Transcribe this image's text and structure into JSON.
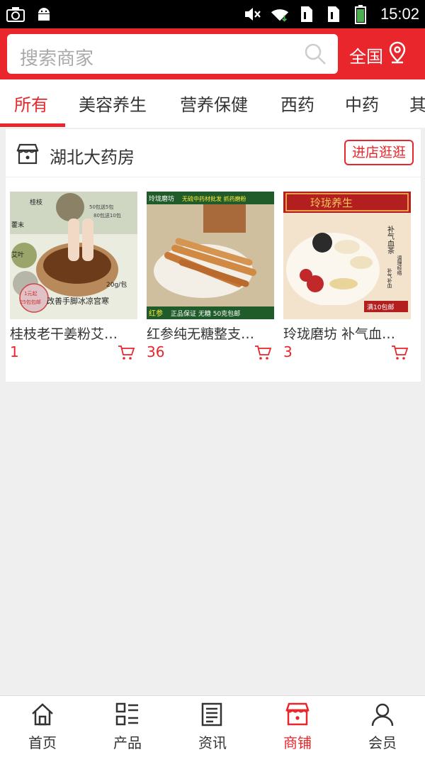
{
  "status_bar": {
    "time": "15:02",
    "icons": [
      "camera-icon",
      "android-icon",
      "mute-icon",
      "wifi-icon",
      "sim1-icon",
      "sim2-icon",
      "battery-icon"
    ]
  },
  "header": {
    "search_placeholder": "搜索商家",
    "region_label": "全国",
    "accent": "#e8262b"
  },
  "tabs": [
    {
      "label": "所有",
      "active": true
    },
    {
      "label": "美容养生"
    },
    {
      "label": "营养保健"
    },
    {
      "label": "西药"
    },
    {
      "label": "中药"
    },
    {
      "label": "其"
    }
  ],
  "shop": {
    "name": "湖北大药房",
    "enter_label": "进店逛逛",
    "products": [
      {
        "title": "桂枝老干姜粉艾…",
        "count": "1",
        "img_text": {
          "a": "桂枝",
          "b": "藿末",
          "c": "艾叶",
          "d": "50包送5包",
          "e": "80包送10包",
          "f": "20g/包",
          "g": "改善手脚冰凉宫寒",
          "h": "1元起",
          "i": "25包包邮"
        }
      },
      {
        "title": "红参纯无糖整支…",
        "count": "36",
        "img_text": {
          "a": "玲珑磨坊",
          "b": "无硫中药材批发 抓药磨粉",
          "c": "红参",
          "d": "正品保证 无糖 50克包邮"
        }
      },
      {
        "title": "玲珑磨坊 补气血…",
        "count": "3",
        "img_text": {
          "a": "玲珑养生",
          "b": "补气血茶",
          "c": "调理经络",
          "d": "补气补血",
          "e": "满10包邮"
        }
      }
    ]
  },
  "bottom_nav": [
    {
      "label": "首页",
      "icon": "home-icon"
    },
    {
      "label": "产品",
      "icon": "product-list-icon"
    },
    {
      "label": "资讯",
      "icon": "news-icon"
    },
    {
      "label": "商铺",
      "icon": "shop-icon",
      "active": true
    },
    {
      "label": "会员",
      "icon": "user-icon"
    }
  ]
}
